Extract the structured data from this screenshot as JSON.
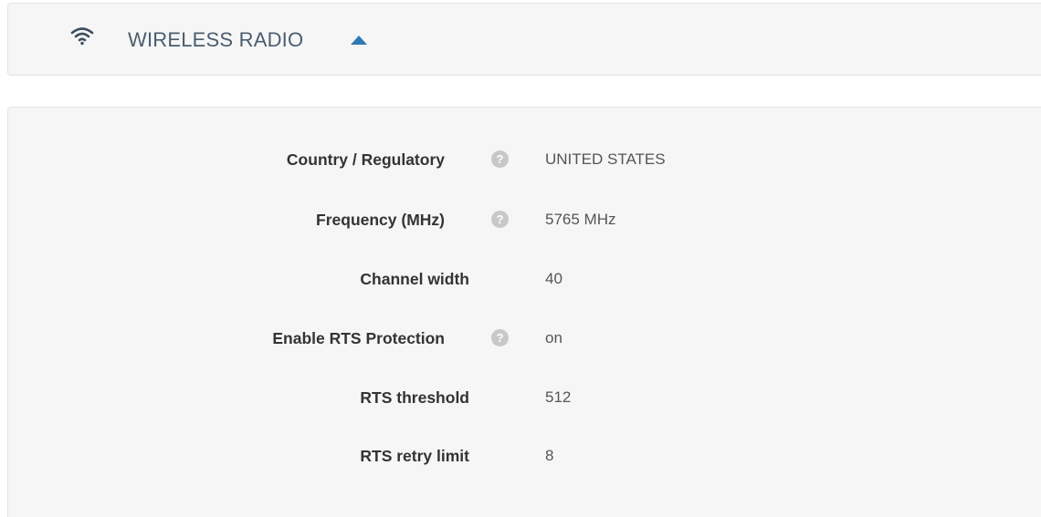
{
  "header": {
    "title": "WIRELESS RADIO",
    "icon": "wifi-icon",
    "toggle_icon": "caret-up-icon",
    "accent_color": "#2f79b5"
  },
  "settings": [
    {
      "label": "Country / Regulatory",
      "value": "UNITED STATES",
      "help": true
    },
    {
      "label": "Frequency (MHz)",
      "value": "5765 MHz",
      "help": true
    },
    {
      "label": "Channel width",
      "value": "40",
      "help": false
    },
    {
      "label": "Enable RTS Protection",
      "value": "on",
      "help": true
    },
    {
      "label": "RTS threshold",
      "value": "512",
      "help": false
    },
    {
      "label": "RTS retry limit",
      "value": "8",
      "help": false
    }
  ],
  "help_icon_glyph": "?"
}
